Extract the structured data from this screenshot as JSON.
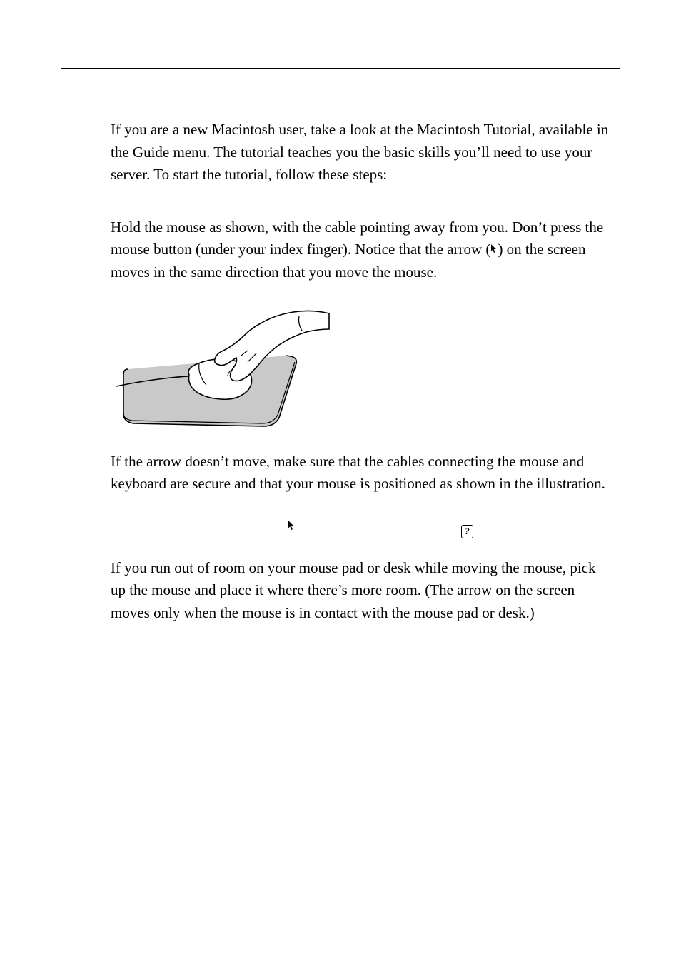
{
  "intro": "If you are a new Macintosh user, take a look at the Macintosh Tutorial, available in the Guide menu. The tutorial teaches you the basic skills you’ll need to use your server. To start the tutorial, follow these steps:",
  "step1_begin": "Hold the mouse as shown, with the cable pointing away from you. Don’t press the mouse button (under your index finger). Notice that the arrow (",
  "step1_end": ") on the screen moves in the same direction that you move the mouse.",
  "note1": "If the arrow doesn’t move, make sure that the cables connecting the mouse and keyboard are secure and that your mouse is positioned as shown in the illustration.",
  "note2": "If you run out of room on your mouse pad or desk while moving the mouse, pick up the mouse and place it where there’s more room. (The arrow on the screen moves only when the mouse is in contact with the mouse pad or desk.)",
  "arrow_glyph": "↖︎",
  "help_glyph": "?"
}
